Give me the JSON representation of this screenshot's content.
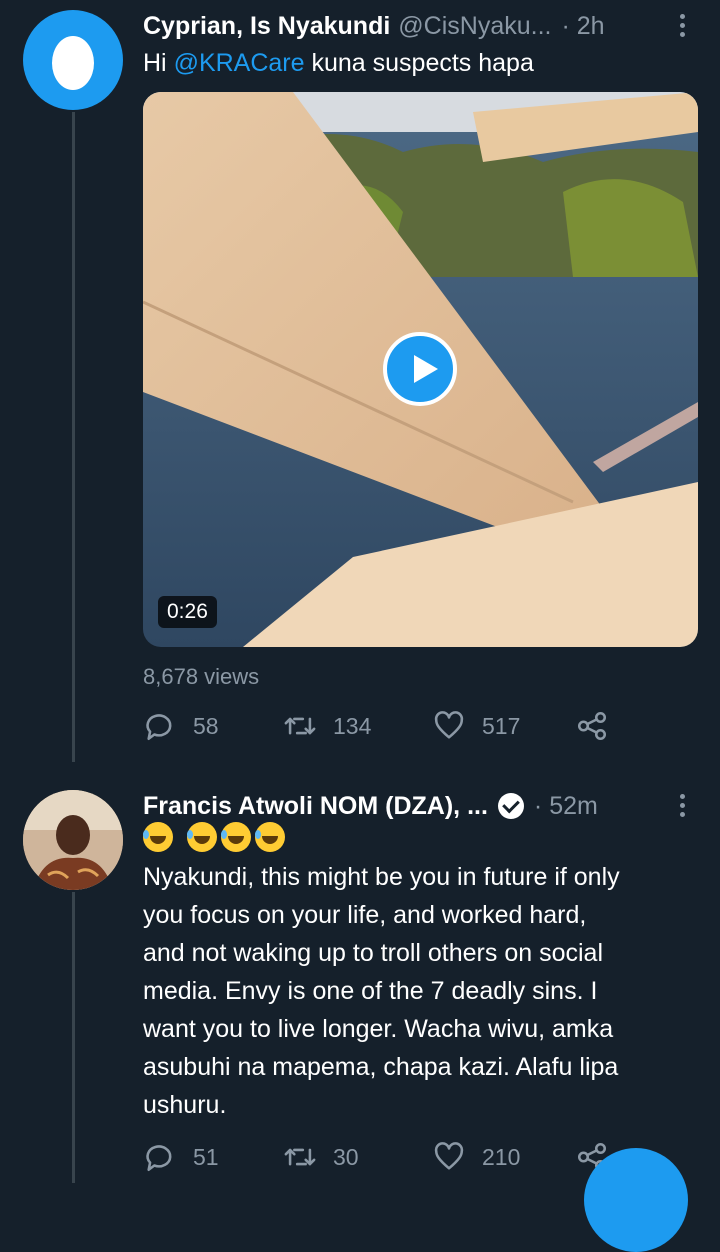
{
  "tweets": [
    {
      "display_name": "Cyprian, Is Nyakundi",
      "handle": "@CisNyaku...",
      "time": "· 2h",
      "text_prefix": "Hi ",
      "mention": "@KRACare",
      "text_suffix": " kuna suspects hapa",
      "video_duration": "0:26",
      "views": "8,678 views",
      "replies": "58",
      "retweets": "134",
      "likes": "517"
    },
    {
      "display_name": "Francis Atwoli NOM (DZA), ...",
      "time": "· 52m",
      "text_lines": [
        "Nyakundi, this might be you in future if only",
        "you focus on your life, and worked hard,",
        "and not waking up to troll others on social",
        "media. Envy is one of the 7 deadly sins. I",
        "want you to live longer. Wacha wivu, amka",
        "asubuhi na mapema, chapa kazi. Alafu lipa",
        "ushuru."
      ],
      "replies": "51",
      "retweets": "30",
      "likes": "210"
    }
  ],
  "icons": {
    "reply": "reply-icon",
    "retweet": "retweet-icon",
    "like": "heart-icon",
    "share": "share-icon",
    "more": "more-options-icon",
    "verified": "verified-badge-icon",
    "emoji": "rolling-laughing-emoji-icon",
    "play": "play-icon"
  },
  "colors": {
    "background": "#15202b",
    "accent": "#1d9bf0",
    "muted": "#8b98a5",
    "thread_line": "#38444d"
  }
}
